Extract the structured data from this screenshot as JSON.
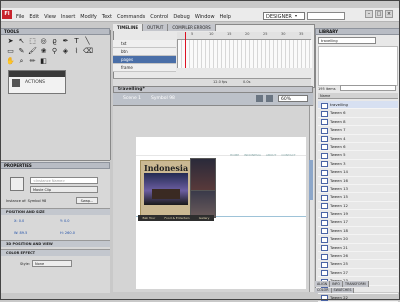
{
  "app": {
    "name": "Fl",
    "workspace": "DESIGNER"
  },
  "menu": [
    "File",
    "Edit",
    "View",
    "Insert",
    "Modify",
    "Text",
    "Commands",
    "Control",
    "Debug",
    "Window",
    "Help"
  ],
  "panels": {
    "tools": "TOOLS",
    "properties": "PROPERTIES",
    "library": "LIBRARY"
  },
  "actions": {
    "label": "ACTIONS"
  },
  "timeline": {
    "tabs": [
      "TIMELINE",
      "OUTPUT",
      "COMPILER ERRORS"
    ],
    "layers": [
      {
        "name": "txt"
      },
      {
        "name": "btn",
        "selected": false
      },
      {
        "name": "pages",
        "selected": true
      },
      {
        "name": "frame"
      }
    ],
    "ruler_marks": [
      "5",
      "10",
      "15",
      "20",
      "25",
      "30",
      "35"
    ],
    "footer": [
      "12.0 fps",
      "0.0s"
    ]
  },
  "document": {
    "tab": "travelling*",
    "scene": "Scene 1",
    "symbol": "Symbol 98",
    "zoom": "60%"
  },
  "stage": {
    "banner_title": "Indonesia",
    "nav": [
      "HOME",
      "INDONESIA",
      "ABOUT",
      "CONTACT"
    ],
    "bottom_links": [
      "Bali Tour",
      "Food & Entertain",
      "Gallery"
    ]
  },
  "properties": {
    "instance_name_placeholder": "<Instance Name>",
    "type": "Movie Clip",
    "instance_of_label": "Instance of:",
    "instance_of_value": "Symbol 98",
    "swap_label": "Swap...",
    "sections": [
      "POSITION AND SIZE",
      "3D POSITION AND VIEW",
      "COLOR EFFECT"
    ],
    "position": {
      "x": "X: 0.0",
      "y": "Y: 0.0",
      "w": "W: 89.5",
      "h": "H: 260.0"
    },
    "style_label": "Style:",
    "style_value": "None"
  },
  "library": {
    "document": "travelling",
    "count": "195 items",
    "column": "Name",
    "items": [
      "travelling",
      "Tween 6",
      "Tween 8",
      "Tween 7",
      "Tween 4",
      "Tween 6",
      "Tween 5",
      "Tween 3",
      "Tween 14",
      "Tween 16",
      "Tween 13",
      "Tween 15",
      "Tween 12",
      "Tween 19",
      "Tween 17",
      "Tween 18",
      "Tween 20",
      "Tween 21",
      "Tween 26",
      "Tween 25",
      "Tween 27",
      "Tween 23",
      "Tween 24",
      "Tween 22"
    ],
    "tabs": [
      "ALIGN",
      "INFO",
      "TRANSFORM"
    ],
    "tabs2": [
      "COLOR",
      "SWATCHES"
    ]
  }
}
